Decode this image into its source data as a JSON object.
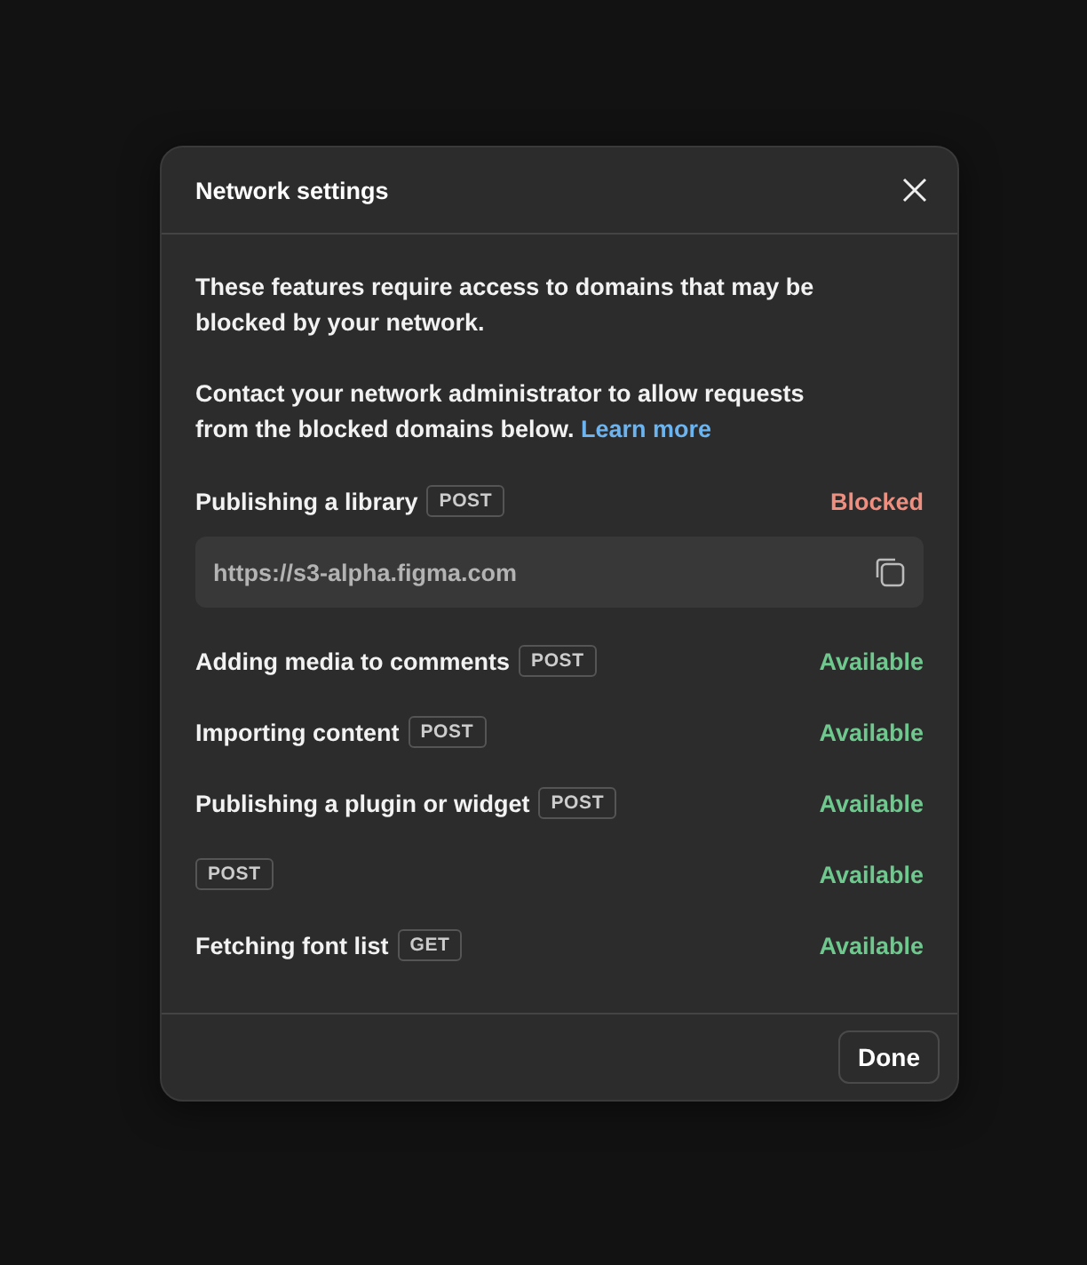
{
  "dialog": {
    "title": "Network settings",
    "intro": "These features require access to domains that may be blocked by your network.",
    "contact": "Contact your network administrator to allow requests from the blocked domains below.",
    "link": "Learn more",
    "features": [
      {
        "name": "Publishing a library",
        "method": "POST",
        "kind": "blocked",
        "status": "Blocked",
        "url": "https://s3-alpha.figma.com"
      },
      {
        "name": "Adding media to comments",
        "method": "POST",
        "kind": "available",
        "status": "Available"
      },
      {
        "name": "Importing content",
        "method": "POST",
        "kind": "available",
        "status": "Available"
      },
      {
        "name": "Publishing a plugin or widget",
        "method": "POST",
        "kind": "available",
        "status": "Available"
      },
      {
        "method": "POST",
        "kind": "available",
        "status": "Available"
      },
      {
        "name": "Fetching font list",
        "method": "GET",
        "kind": "available",
        "status": "Available"
      }
    ],
    "done": "Done"
  }
}
